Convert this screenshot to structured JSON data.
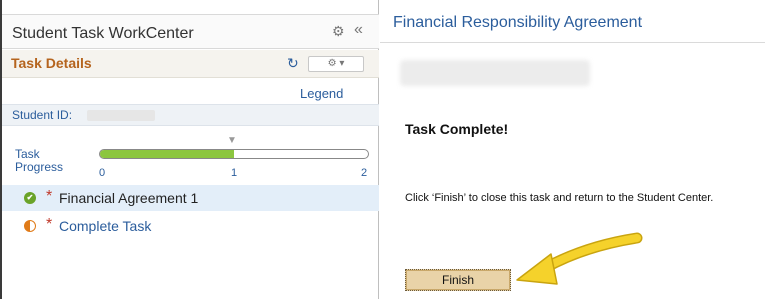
{
  "workcenter": {
    "title": "Student Task WorkCenter",
    "gear_icon": "gear-icon",
    "collapse_icon": "double-chevron-left-icon"
  },
  "task_details": {
    "title": "Task Details",
    "refresh_icon": "refresh-icon",
    "actions_icon": "gear-dropdown-icon",
    "legend_label": "Legend"
  },
  "student": {
    "id_label": "Student ID:"
  },
  "progress": {
    "label_line1": "Task",
    "label_line2": "Progress",
    "value": 1,
    "max": 2,
    "ticks": [
      "0",
      "1",
      "2"
    ]
  },
  "tasks": [
    {
      "label": "Financial Agreement 1",
      "status": "complete",
      "status_icon": "check-circle-icon",
      "required": "*",
      "selected": true
    },
    {
      "label": "Complete Task",
      "status": "in-progress",
      "status_icon": "half-circle-icon",
      "required": "*",
      "selected": false
    }
  ],
  "content": {
    "title": "Financial Responsibility Agreement",
    "heading": "Task Complete!",
    "message": "Click ‘Finish’ to close this task and return to the Student Center.",
    "finish_label": "Finish"
  },
  "colors": {
    "accent_blue": "#2b5d9c",
    "task_details_orange": "#b5641e",
    "progress_green": "#8cc63f",
    "finish_button": "#e9d3a8",
    "arrow_yellow": "#f5d22b"
  }
}
